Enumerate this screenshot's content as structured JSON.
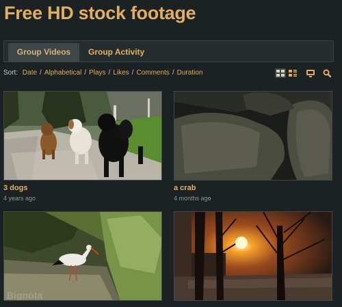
{
  "page": {
    "title": "Free HD stock footage"
  },
  "tabs": [
    {
      "label": "Group Videos",
      "active": true
    },
    {
      "label": "Group Activity",
      "active": false
    }
  ],
  "sort": {
    "label": "Sort:",
    "options": [
      "Date",
      "Alphabetical",
      "Plays",
      "Likes",
      "Comments",
      "Duration"
    ],
    "separator": "/"
  },
  "view_icons": [
    "grid-view-icon",
    "list-view-icon",
    "monitor-icon",
    "search-icon"
  ],
  "videos": [
    {
      "title": "3 dogs",
      "age": "4 years ago",
      "thumbnail": "dogs-thumbnail"
    },
    {
      "title": "a crab",
      "age": "4 months ago",
      "thumbnail": "crab-thumbnail"
    },
    {
      "title": "",
      "age": "",
      "thumbnail": "stork-thumbnail"
    },
    {
      "title": "",
      "age": "",
      "thumbnail": "sunset-thumbnail"
    }
  ],
  "watermark": "Bignota",
  "colors": {
    "background": "#1c2123",
    "accent": "#e6b25f",
    "tabbar": "#262d2f",
    "active_tab": "#3d4649"
  }
}
